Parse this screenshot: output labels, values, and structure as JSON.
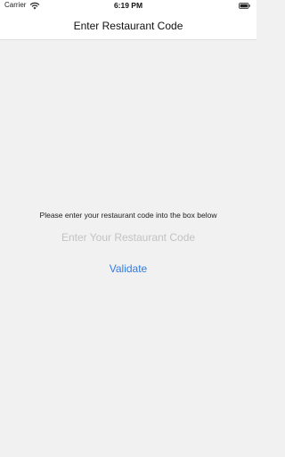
{
  "status_bar": {
    "carrier": "Carrier",
    "time": "6:19 PM",
    "wifi_icon": "wifi-icon",
    "battery_icon": "battery-icon"
  },
  "nav": {
    "title": "Enter Restaurant Code"
  },
  "main": {
    "instruction": "Please enter your restaurant code into the box below",
    "code_input": {
      "value": "",
      "placeholder": "Enter Your Restaurant Code"
    },
    "validate_label": "Validate"
  },
  "colors": {
    "accent": "#2f7ce5",
    "background": "#f1f1f1",
    "bar_background": "#ffffff",
    "placeholder": "#c2c2c2"
  }
}
